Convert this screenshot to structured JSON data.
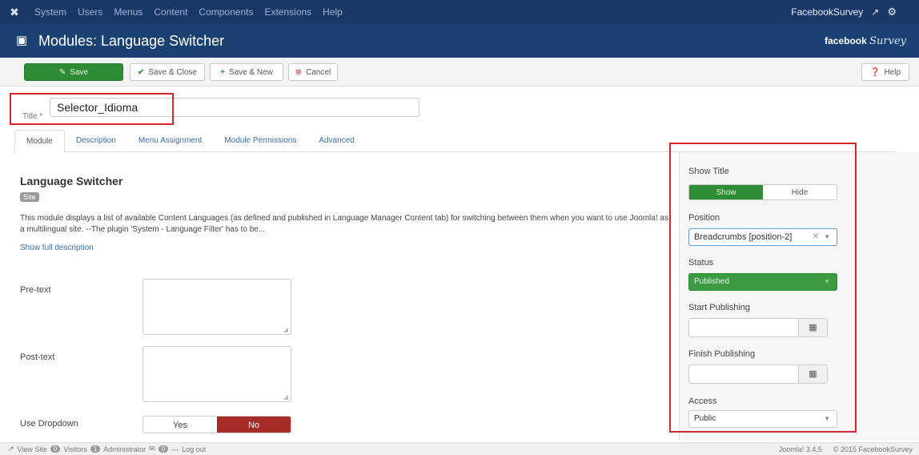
{
  "navbar": {
    "logo_icon": "joomla-icon",
    "menu": [
      "System",
      "Users",
      "Menus",
      "Content",
      "Components",
      "Extensions",
      "Help"
    ],
    "site_name": "FacebookSurvey",
    "site_icon": "external-link-icon",
    "settings_icon": "gear-icon"
  },
  "header": {
    "title": "Modules: Language Switcher",
    "brand_bold": "facebook",
    "brand_script": "Survey"
  },
  "toolbar": {
    "save": "Save",
    "save_close": "Save & Close",
    "save_new": "Save & New",
    "cancel": "Cancel",
    "help": "Help"
  },
  "title_field": {
    "label": "Title *",
    "value": "Selector_Idioma"
  },
  "tabs": [
    "Module",
    "Description",
    "Menu Assignment",
    "Module Permissions",
    "Advanced"
  ],
  "module": {
    "heading": "Language Switcher",
    "badge": "Site",
    "description": "This module displays a list of available Content Languages (as defined and published in Language Manager Content tab) for switching between them when you want to use Joomla! as a multilingual site. --The plugin 'System - Language Filter' has to be...",
    "show_full": "Show full description"
  },
  "fields": {
    "pre_text": "Pre-text",
    "post_text": "Post-text",
    "use_dropdown": "Use Dropdown",
    "yes": "Yes",
    "no": "No"
  },
  "panel": {
    "show_title_label": "Show Title",
    "show": "Show",
    "hide": "Hide",
    "position_label": "Position",
    "position_value": "Breadcrumbs [position-2]",
    "status_label": "Status",
    "status_value": "Published",
    "start_label": "Start Publishing",
    "finish_label": "Finish Publishing",
    "access_label": "Access",
    "access_value": "Public"
  },
  "footer": {
    "view_site": "View Site",
    "visitors_count": "0",
    "visitors": "Visitors",
    "admin_count": "1",
    "administrator": "Administrator",
    "messages_count": "0",
    "logout": "Log out",
    "version": "Joomla! 3.4.5",
    "copyright": "© 2015 FacebookSurvey"
  }
}
